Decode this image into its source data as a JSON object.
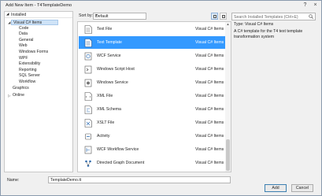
{
  "window": {
    "title": "Add New Item - T4TemplateDemo"
  },
  "left": {
    "header": "Installed",
    "root": "Visual C# Items",
    "children": [
      "Code",
      "Data",
      "General",
      "Web",
      "Windows Forms",
      "WPF",
      "Extensibility",
      "Reporting",
      "SQL Server",
      "Workflow"
    ],
    "graphics": "Graphics",
    "online": "Online"
  },
  "toolbar": {
    "sort_label": "Sort by:",
    "sort_value": "Default"
  },
  "search": {
    "placeholder": "Search Installed Templates (Ctrl+E)"
  },
  "templates": [
    {
      "name": "Text File",
      "category": "Visual C# Items",
      "icon": "text-file-icon"
    },
    {
      "name": "Text Template",
      "category": "Visual C# Items",
      "icon": "text-template-icon"
    },
    {
      "name": "WCF Service",
      "category": "Visual C# Items",
      "icon": "wcf-service-icon"
    },
    {
      "name": "Windows Script Host",
      "category": "Visual C# Items",
      "icon": "script-icon"
    },
    {
      "name": "Windows Service",
      "category": "Visual C# Items",
      "icon": "windows-service-icon"
    },
    {
      "name": "XML File",
      "category": "Visual C# Items",
      "icon": "xml-file-icon"
    },
    {
      "name": "XML Schema",
      "category": "Visual C# Items",
      "icon": "xml-schema-icon"
    },
    {
      "name": "XSLT File",
      "category": "Visual C# Items",
      "icon": "xslt-file-icon"
    },
    {
      "name": "Activity",
      "category": "Visual C# Items",
      "icon": "activity-icon"
    },
    {
      "name": "WCF Workflow Service",
      "category": "Visual C# Items",
      "icon": "wcf-workflow-icon"
    },
    {
      "name": "Directed Graph Document",
      "category": "Visual C# Items",
      "icon": "graph-document-icon"
    }
  ],
  "selected_index": 1,
  "details": {
    "type_label": "Type:",
    "type_value": "Visual C# Items",
    "description": "A C# template for the T4 text template transformation system"
  },
  "name_field": {
    "label": "Name:",
    "value": "TemplateDemo.tt"
  },
  "buttons": {
    "add": "Add",
    "cancel": "Cancel"
  },
  "colors": {
    "selection": "#3399ff",
    "tree_selection": "#cfe3f7"
  }
}
